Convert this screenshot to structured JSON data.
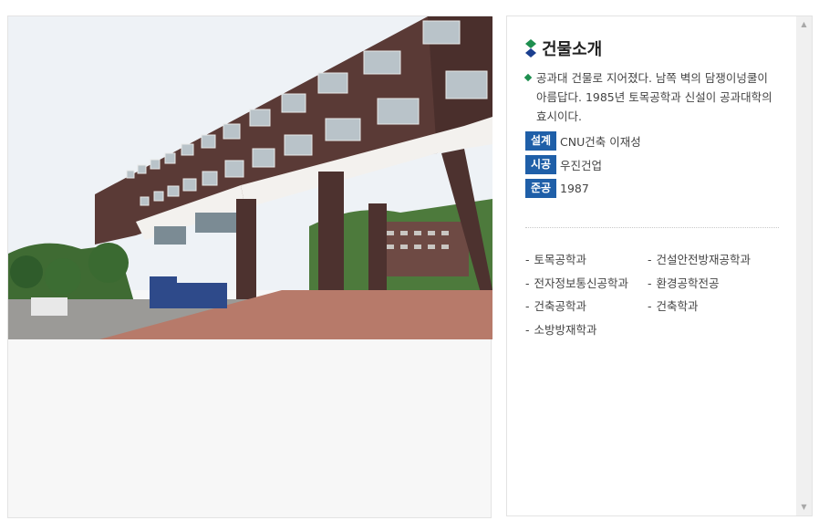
{
  "section": {
    "title": "건물소개",
    "description": "공과대 건물로 지어졌다. 남쪽 벽의 담쟁이넝쿨이 아름답다. 1985년 토목공학과 신설이 공과대학의 효시이다."
  },
  "specs": [
    {
      "label": "설계",
      "value": "CNU건축 이재성"
    },
    {
      "label": "시공",
      "value": "우진건업"
    },
    {
      "label": "준공",
      "value": "1987"
    }
  ],
  "departments": [
    "토목공학과",
    "건설안전방재공학과",
    "전자정보통신공학과",
    "환경공학전공",
    "건축공학과",
    "건축학과",
    "소방방재학과"
  ],
  "colors": {
    "accent_blue": "#1f5fa8",
    "accent_green": "#1e8f4f",
    "navy": "#1b3f8f"
  },
  "icons": {
    "title": "diamond-icon",
    "scroll_up": "scroll-up-arrow-icon",
    "scroll_down": "scroll-down-arrow-icon"
  }
}
